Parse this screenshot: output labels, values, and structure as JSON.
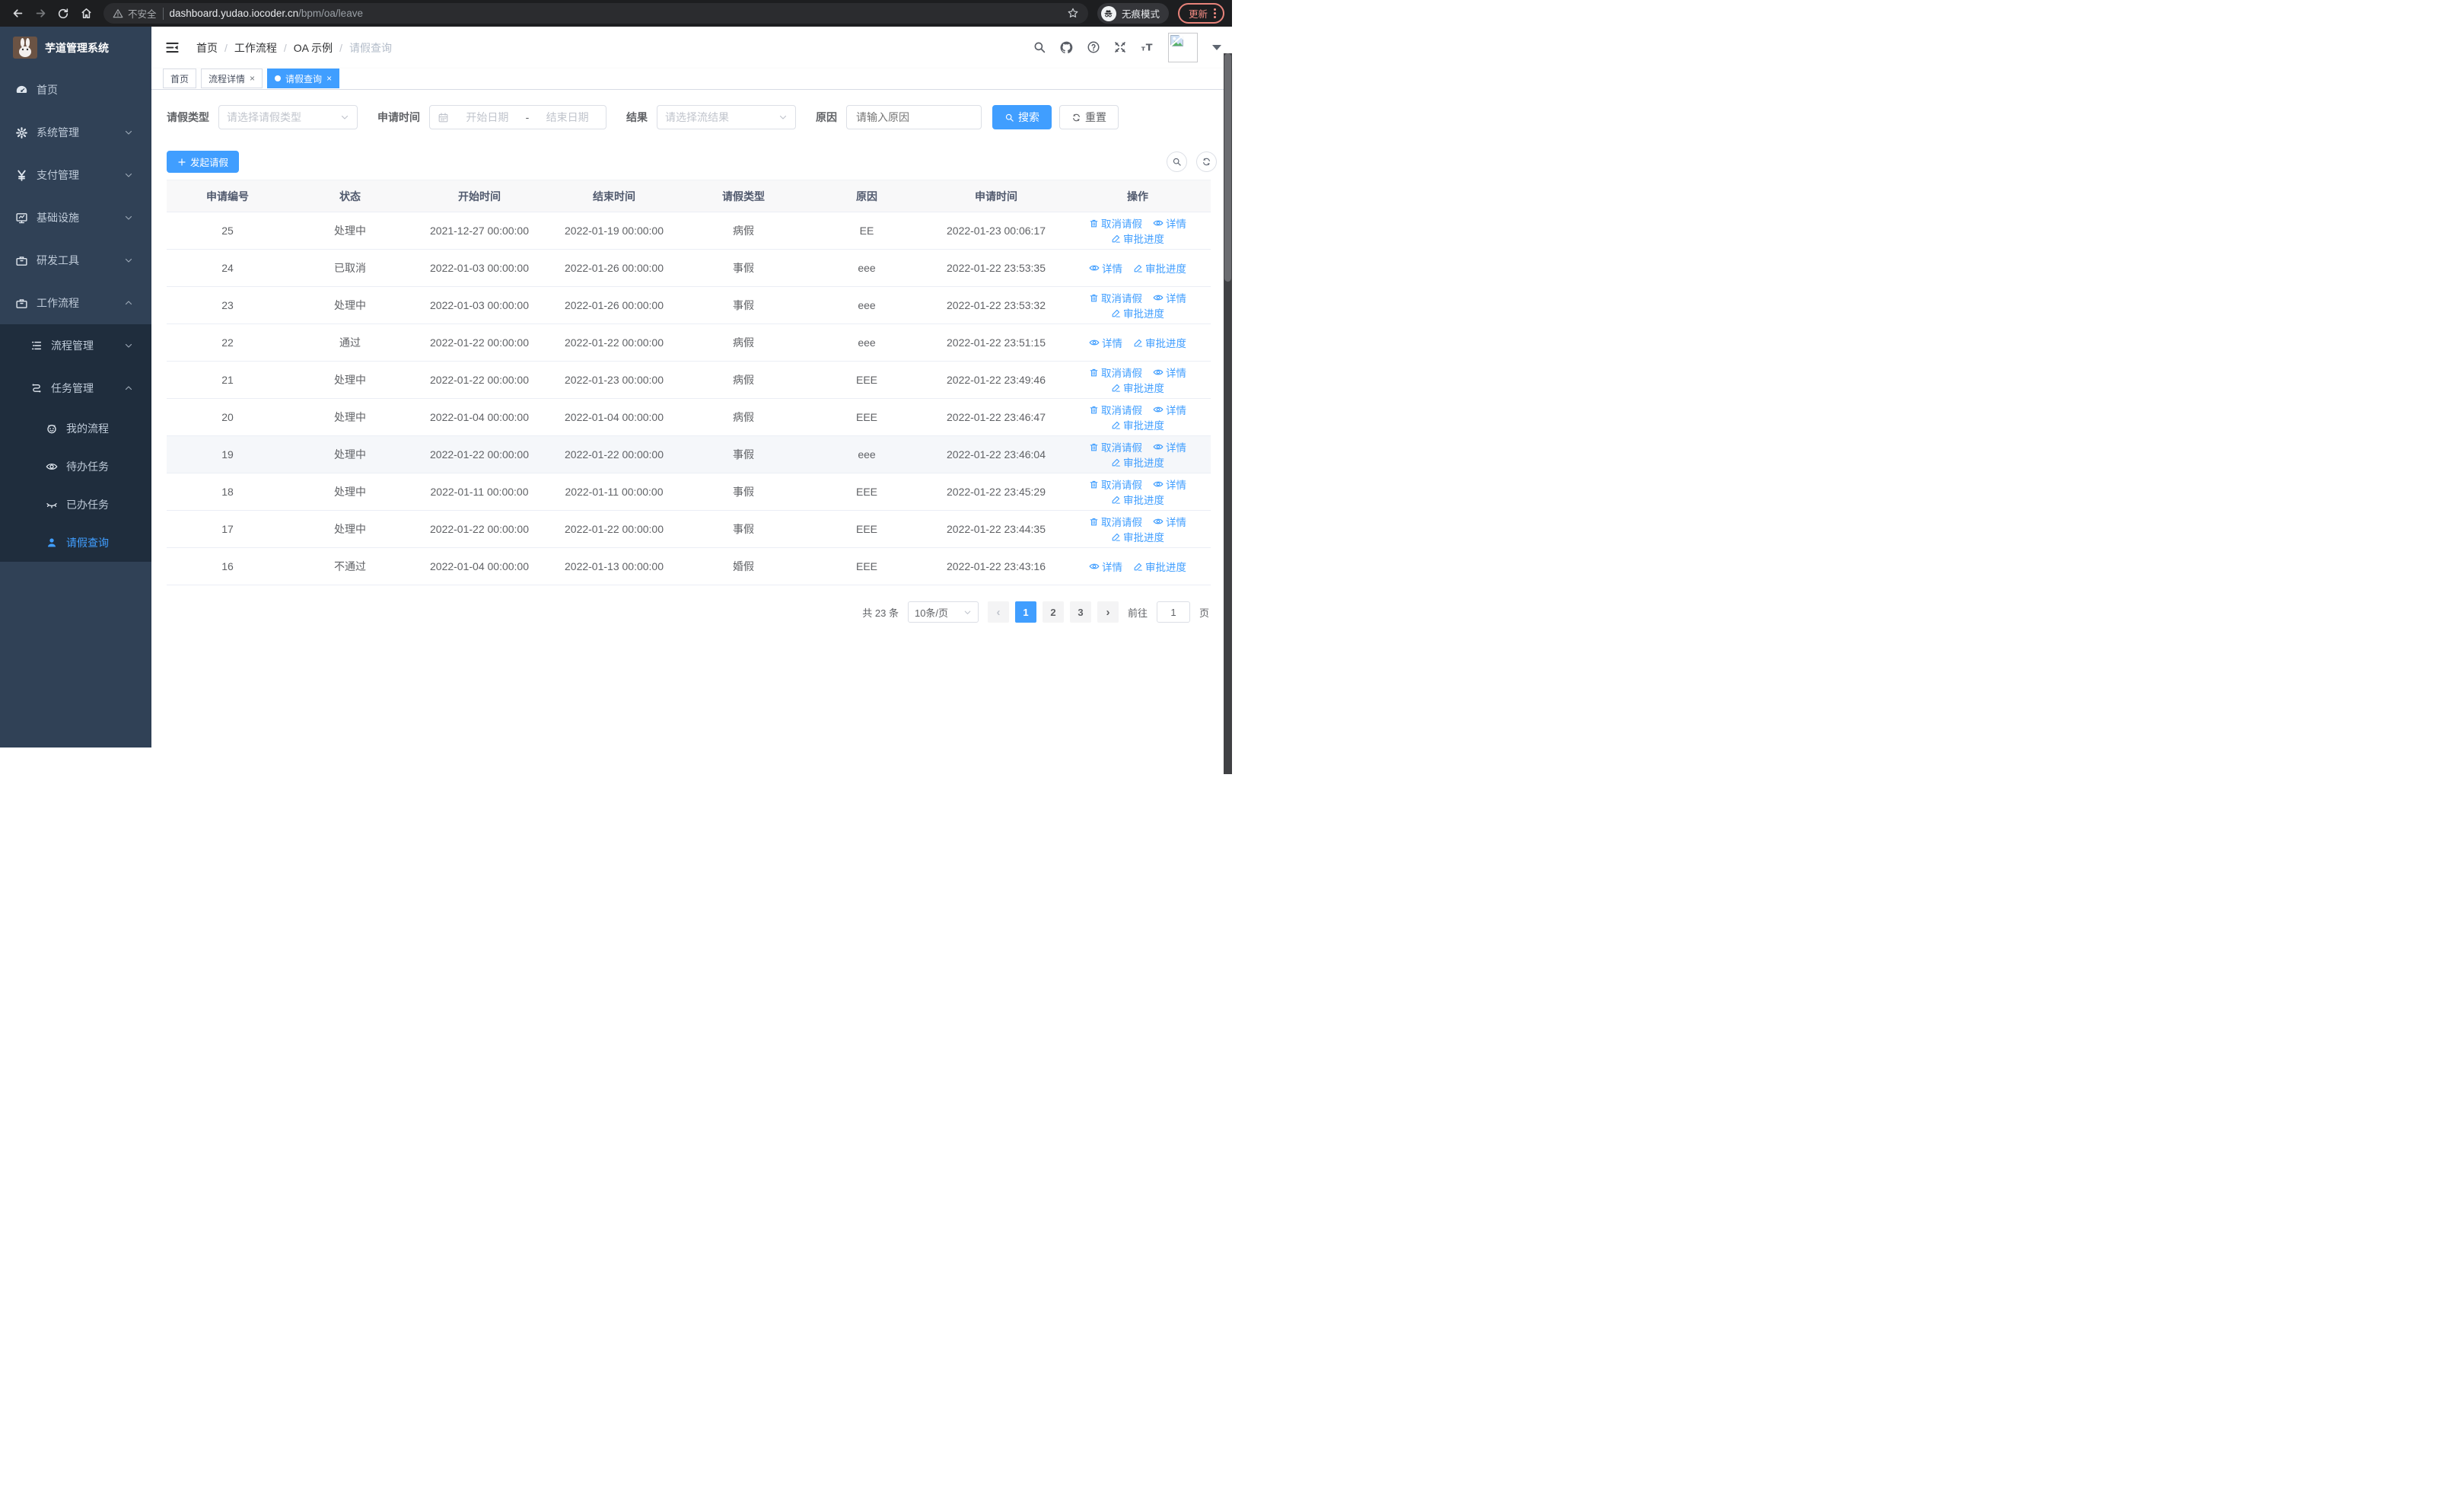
{
  "browser": {
    "security_label": "不安全",
    "url_host": "dashboard.yudao.iocoder.cn",
    "url_path": "/bpm/oa/leave",
    "incognito_label": "无痕模式",
    "update_label": "更新"
  },
  "sidebar": {
    "title": "芋道管理系统",
    "menu": [
      {
        "label": "首页"
      },
      {
        "label": "系统管理"
      },
      {
        "label": "支付管理"
      },
      {
        "label": "基础设施"
      },
      {
        "label": "研发工具"
      },
      {
        "label": "工作流程"
      }
    ],
    "submenu": [
      {
        "label": "流程管理"
      },
      {
        "label": "任务管理"
      },
      {
        "label": "我的流程"
      },
      {
        "label": "待办任务"
      },
      {
        "label": "已办任务"
      },
      {
        "label": "请假查询"
      }
    ]
  },
  "header": {
    "breadcrumb": [
      "首页",
      "工作流程",
      "OA 示例",
      "请假查询"
    ],
    "separator": "/"
  },
  "tabs": [
    {
      "label": "首页"
    },
    {
      "label": "流程详情"
    },
    {
      "label": "请假查询"
    }
  ],
  "ui": {
    "close_glyph": "×",
    "prev_glyph": "‹",
    "next_glyph": "›"
  },
  "filters": {
    "leave_type_label": "请假类型",
    "leave_type_placeholder": "请选择请假类型",
    "apply_time_label": "申请时间",
    "start_date_placeholder": "开始日期",
    "range_separator": "-",
    "end_date_placeholder": "结束日期",
    "result_label": "结果",
    "result_placeholder": "请选择流结果",
    "reason_label": "原因",
    "reason_placeholder": "请输入原因",
    "search_label": "搜索",
    "reset_label": "重置"
  },
  "toolbar": {
    "create_label": "发起请假"
  },
  "table": {
    "columns": [
      "申请编号",
      "状态",
      "开始时间",
      "结束时间",
      "请假类型",
      "原因",
      "申请时间",
      "操作"
    ],
    "action_labels": {
      "cancel": "取消请假",
      "detail": "详情",
      "progress": "审批进度"
    },
    "rows": [
      {
        "id": "25",
        "status": "处理中",
        "start": "2021-12-27 00:00:00",
        "end": "2022-01-19 00:00:00",
        "type": "病假",
        "reason": "EE",
        "applied": "2022-01-23 00:06:17"
      },
      {
        "id": "24",
        "status": "已取消",
        "start": "2022-01-03 00:00:00",
        "end": "2022-01-26 00:00:00",
        "type": "事假",
        "reason": "eee",
        "applied": "2022-01-22 23:53:35"
      },
      {
        "id": "23",
        "status": "处理中",
        "start": "2022-01-03 00:00:00",
        "end": "2022-01-26 00:00:00",
        "type": "事假",
        "reason": "eee",
        "applied": "2022-01-22 23:53:32"
      },
      {
        "id": "22",
        "status": "通过",
        "start": "2022-01-22 00:00:00",
        "end": "2022-01-22 00:00:00",
        "type": "病假",
        "reason": "eee",
        "applied": "2022-01-22 23:51:15"
      },
      {
        "id": "21",
        "status": "处理中",
        "start": "2022-01-22 00:00:00",
        "end": "2022-01-23 00:00:00",
        "type": "病假",
        "reason": "EEE",
        "applied": "2022-01-22 23:49:46"
      },
      {
        "id": "20",
        "status": "处理中",
        "start": "2022-01-04 00:00:00",
        "end": "2022-01-04 00:00:00",
        "type": "病假",
        "reason": "EEE",
        "applied": "2022-01-22 23:46:47"
      },
      {
        "id": "19",
        "status": "处理中",
        "start": "2022-01-22 00:00:00",
        "end": "2022-01-22 00:00:00",
        "type": "事假",
        "reason": "eee",
        "applied": "2022-01-22 23:46:04"
      },
      {
        "id": "18",
        "status": "处理中",
        "start": "2022-01-11 00:00:00",
        "end": "2022-01-11 00:00:00",
        "type": "事假",
        "reason": "EEE",
        "applied": "2022-01-22 23:45:29"
      },
      {
        "id": "17",
        "status": "处理中",
        "start": "2022-01-22 00:00:00",
        "end": "2022-01-22 00:00:00",
        "type": "事假",
        "reason": "EEE",
        "applied": "2022-01-22 23:44:35"
      },
      {
        "id": "16",
        "status": "不通过",
        "start": "2022-01-04 00:00:00",
        "end": "2022-01-13 00:00:00",
        "type": "婚假",
        "reason": "EEE",
        "applied": "2022-01-22 23:43:16"
      }
    ]
  },
  "pagination": {
    "total_label": "共 23 条",
    "page_size": "10条/页",
    "pages": [
      "1",
      "2",
      "3"
    ],
    "goto_label": "前往",
    "goto_value": "1",
    "page_label": "页"
  },
  "colors": {
    "accent": "#409eff",
    "sidebar_bg": "#304156",
    "submenu_bg": "#1f2d3d",
    "update_button": "#f28b82"
  }
}
